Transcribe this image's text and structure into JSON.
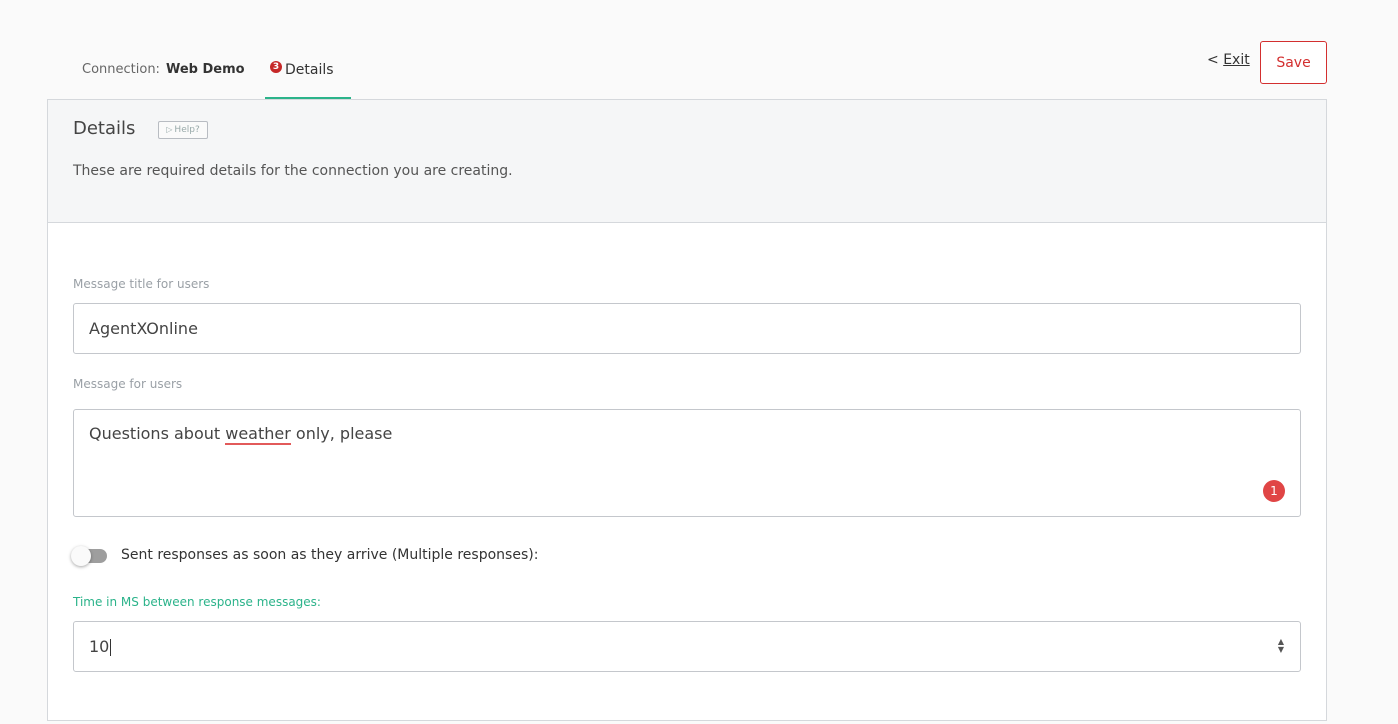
{
  "header": {
    "connection_label": "Connection:",
    "connection_name": "Web Demo",
    "tab_label": "Details",
    "tab_badge": "3",
    "exit_prefix": "<",
    "exit_label": "Exit",
    "save_label": "Save"
  },
  "card": {
    "title": "Details",
    "help_label": "Help?",
    "description": "These are required details for the connection you are creating."
  },
  "form": {
    "title_field": {
      "label": "Message title for users",
      "value": "AgentXOnline"
    },
    "message_field": {
      "label": "Message for users",
      "value_before": "Questions about ",
      "value_misspelled": "weather",
      "value_after": " only, please",
      "badge_count": "1"
    },
    "toggle": {
      "label": "Sent responses as soon as they arrive (Multiple responses):",
      "on": false
    },
    "delay_field": {
      "label": "Time in MS between response messages:",
      "value": "10"
    }
  },
  "colors": {
    "accent": "#2bb38a",
    "danger": "#d32f2f",
    "badge": "#c62828"
  }
}
